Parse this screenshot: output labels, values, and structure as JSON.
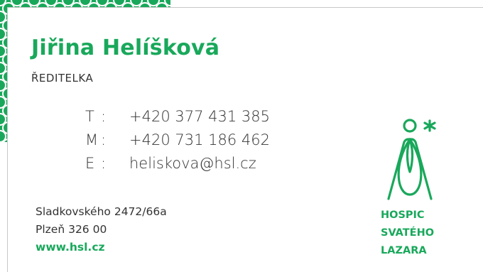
{
  "person": {
    "name": "Jiřina Helíšková",
    "role": "ŘEDITELKA"
  },
  "contacts": [
    {
      "key": "T",
      "sep": ":",
      "value": "+420 377 431 385"
    },
    {
      "key": "M",
      "sep": ":",
      "value": "+420 731 186 462"
    },
    {
      "key": "E",
      "sep": ":",
      "value": "heliskova@hsl.cz"
    }
  ],
  "address": {
    "street": "Sladkovského 2472/66a",
    "city": "Plzeň 326 00",
    "web": "www.hsl.cz"
  },
  "logo": {
    "line1": "HOSPIC",
    "line2": "SVATÉHO",
    "line3": "LAZARA",
    "icon": "angel-figure-icon"
  },
  "colors": {
    "brand_green": "#19a85b",
    "text": "#333333"
  }
}
